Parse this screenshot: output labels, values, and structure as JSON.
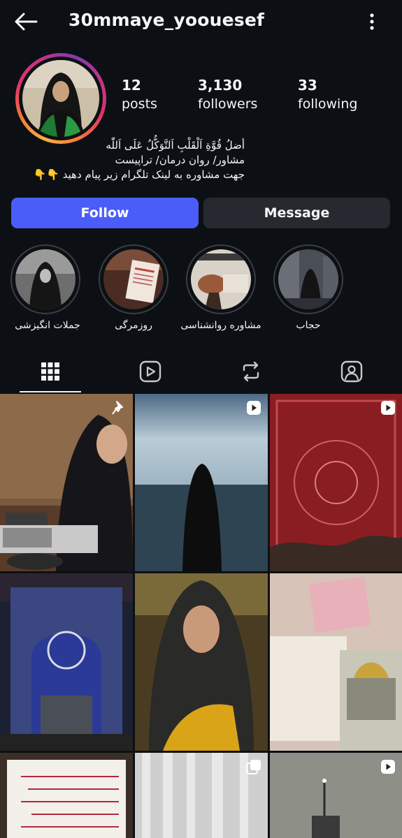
{
  "header": {
    "username": "30mmaye_yoouesef",
    "back_icon": "arrow-left-icon",
    "menu_icon": "more-vertical-icon"
  },
  "profile": {
    "stats": [
      {
        "value": "12",
        "label": "posts"
      },
      {
        "value": "3,130",
        "label": "followers"
      },
      {
        "value": "33",
        "label": "following"
      }
    ],
    "bio_lines": [
      "أضلُ قُوَّةِ اَلْقَلْبِ اَلتَّوَكُّلُ عَلَى اَللّٰه",
      "مشاور/ روان درمان/ تراپیست",
      "جهت مشاوره به لینک تلگرام زیر پیام دهید"
    ],
    "bio_emoji": "👇👇"
  },
  "actions": {
    "follow": "Follow",
    "message": "Message"
  },
  "highlights": [
    {
      "label": "جملات انگیزشی"
    },
    {
      "label": "روزمرگی"
    },
    {
      "label": "مشاوره روانشناسی"
    },
    {
      "label": "حجاب"
    }
  ],
  "tabs": [
    {
      "icon": "grid-icon",
      "active": true
    },
    {
      "icon": "reels-icon",
      "active": false
    },
    {
      "icon": "repost-icon",
      "active": false
    },
    {
      "icon": "tagged-icon",
      "active": false
    }
  ],
  "posts": [
    {
      "badge": "pin-icon"
    },
    {
      "badge": "reel-icon"
    },
    {
      "badge": "reel-icon"
    },
    {
      "badge": null
    },
    {
      "badge": null
    },
    {
      "badge": null
    },
    {
      "badge": null
    },
    {
      "badge": "carousel-icon"
    },
    {
      "badge": "reel-icon"
    }
  ],
  "colors": {
    "background": "#0c1014",
    "follow_button": "#4a5df9",
    "message_button": "#262a30",
    "text": "#f5f5f5"
  }
}
